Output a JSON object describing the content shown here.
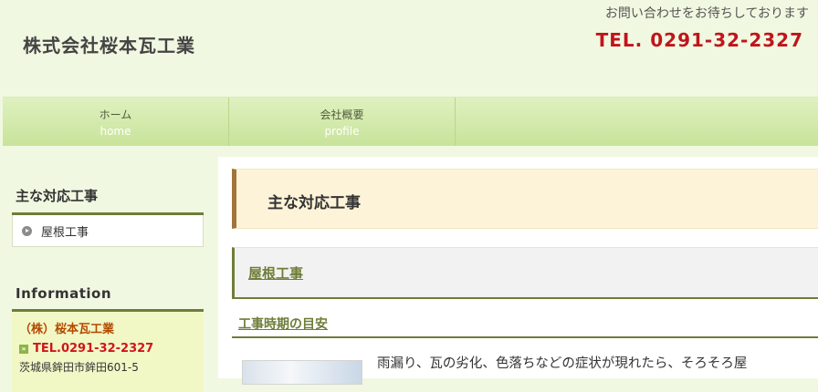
{
  "header": {
    "site_title": "株式会社桜本瓦工業",
    "tagline": "お問い合わせをお待ちしております",
    "tel": "TEL. 0291-32-2327"
  },
  "nav": [
    {
      "jp": "ホーム",
      "en": "home"
    },
    {
      "jp": "会社概要",
      "en": "profile"
    }
  ],
  "sidebar": {
    "works_heading": "主な対応工事",
    "works_items": [
      "屋根工事"
    ],
    "info_heading": "Information",
    "info_company": "（株）桜本瓦工業",
    "info_tel": "TEL.0291-32-2327",
    "info_address": "茨城県鉾田市鉾田601-5"
  },
  "main": {
    "page_title": "主な対応工事",
    "section_title": "屋根工事",
    "sub_title": "工事時期の目安",
    "body_text": "雨漏り、瓦の劣化、色落ちなどの症状が現れたら、そろそろ屋"
  },
  "colors": {
    "accent": "#6e7d38",
    "tel": "#c0151b",
    "nav": "#c8e39a",
    "background": "#f1f8e1"
  }
}
